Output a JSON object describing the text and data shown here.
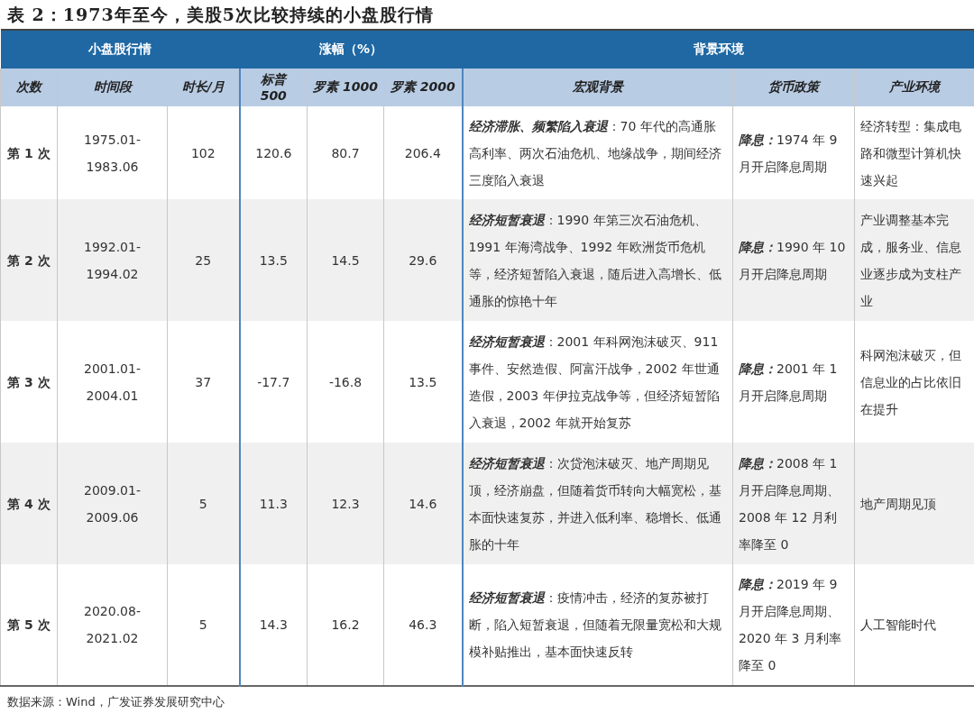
{
  "title": "表 2：1973年至今，美股5次比较持续的小盘股行情",
  "table": {
    "header_groups": [
      {
        "label": "小盘股行情",
        "columns": [
          "次数",
          "时间段",
          "时长/月"
        ]
      },
      {
        "label": "涨幅（%）",
        "columns": [
          "标普 500",
          "罗素 1000",
          "罗素 2000"
        ]
      },
      {
        "label": "背景环境",
        "columns": [
          "宏观背景",
          "货币政策",
          "产业环境"
        ]
      }
    ],
    "rows": [
      {
        "cells": [
          "第 1 次",
          "1975.01-1983.06",
          "102",
          "120.6",
          "80.7",
          "206.4",
          "**经济滞胀、频繁陷入衰退**：70 年代的高通胀高利率、两次石油危机、地缘战争，期间经济三度陷入衰退",
          "**降息：**1974 年 9 月开启降息周期",
          "经济转型：集成电路和微型计算机快速兴起"
        ]
      },
      {
        "cells": [
          "第 2 次",
          "1992.01-1994.02",
          "25",
          "13.5",
          "14.5",
          "29.6",
          "**经济短暂衰退**：1990 年第三次石油危机、1991 年海湾战争、1992 年欧洲货币危机等，经济短暂陷入衰退，随后进入高增长、低通胀的惊艳十年",
          "**降息：**1990 年 10 月开启降息周期",
          "产业调整基本完成，服务业、信息业逐步成为支柱产业"
        ]
      },
      {
        "cells": [
          "第 3 次",
          "2001.01-2004.01",
          "37",
          "-17.7",
          "-16.8",
          "13.5",
          "**经济短暂衰退**：2001 年科网泡沫破灭、911 事件、安然造假、阿富汗战争，2002 年世通造假，2003 年伊拉克战争等，但经济短暂陷入衰退，2002 年就开始复苏",
          "**降息：**2001 年 1 月开启降息周期",
          "科网泡沫破灭，但信息业的占比依旧在提升"
        ]
      },
      {
        "cells": [
          "第 4 次",
          "2009.01-2009.06",
          "5",
          "11.3",
          "12.3",
          "14.6",
          "**经济短暂衰退**：次贷泡沫破灭、地产周期见顶，经济崩盘，但随着货币转向大幅宽松，基本面快速复苏，并进入低利率、稳增长、低通胀的十年",
          "**降息：**2008 年 1 月开启降息周期、2008 年 12 月利率降至 0",
          "地产周期见顶"
        ]
      },
      {
        "cells": [
          "第 5 次",
          "2020.08-2021.02",
          "5",
          "14.3",
          "16.2",
          "46.3",
          "**经济短暂衰退**：疫情冲击，经济的复苏被打断，陷入短暂衰退，但随着无限量宽松和大规模补贴推出，基本面快速反转",
          "**降息：**2019 年 9 月开启降息周期、2020 年 3 月利率降至 0",
          "人工智能时代"
        ]
      }
    ]
  },
  "source": "数据来源：Wind，广发证券发展研究中心"
}
